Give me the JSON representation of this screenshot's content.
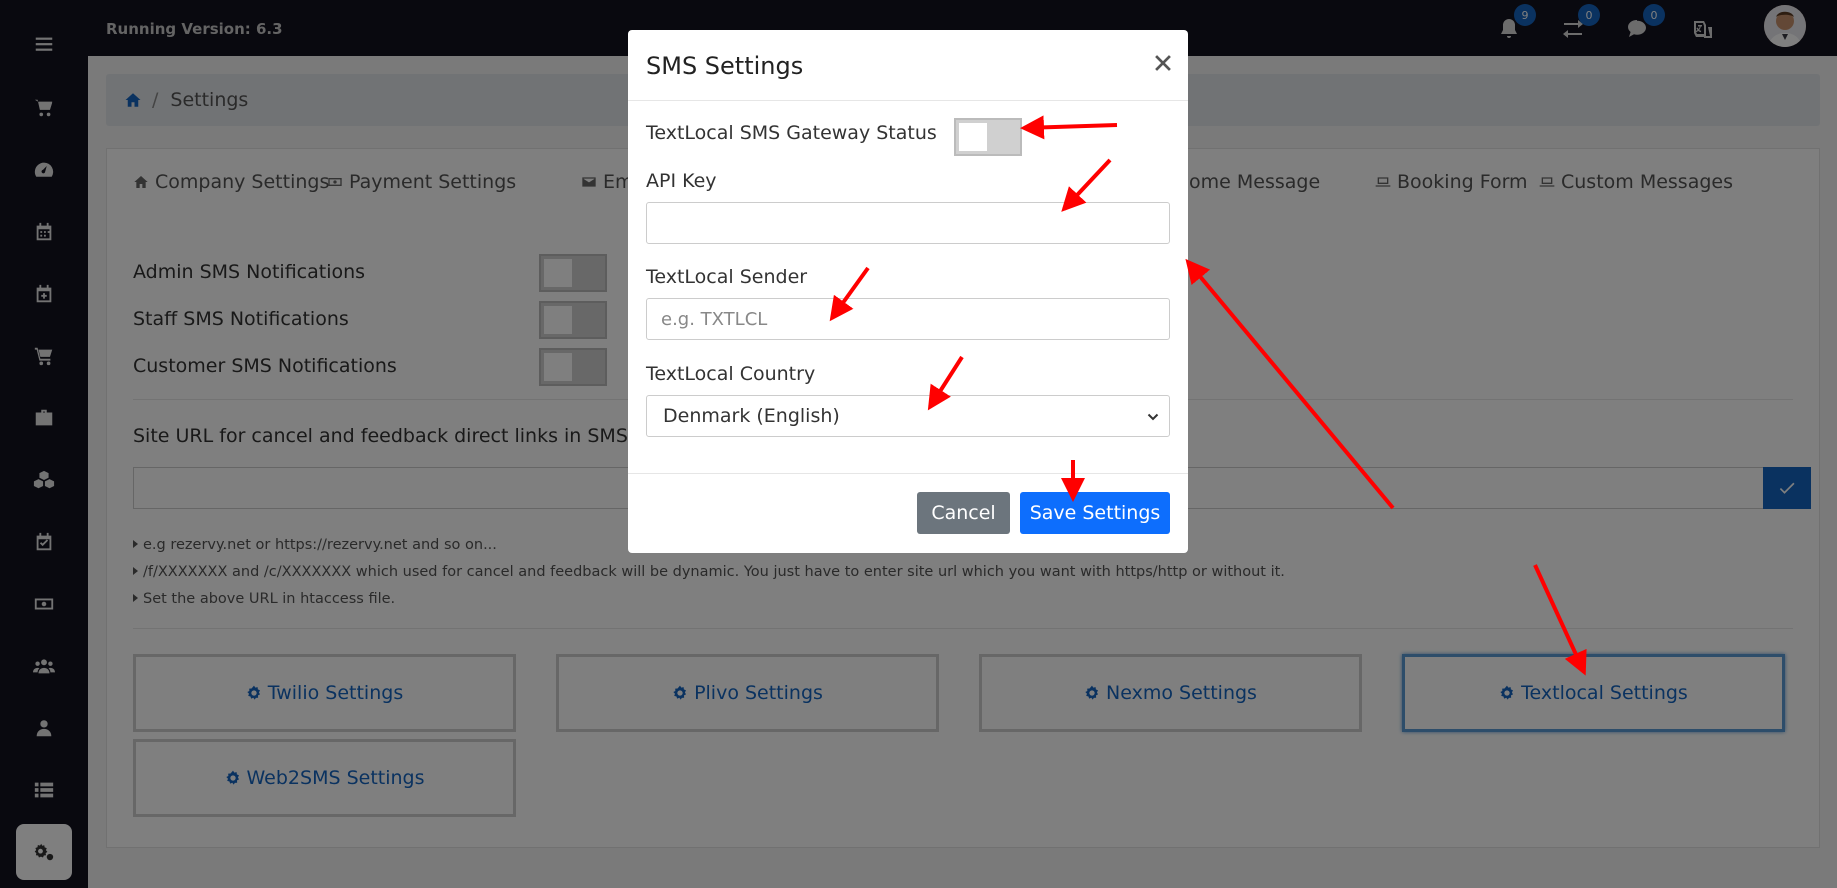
{
  "topbar": {
    "version": "Running Version: 6.3",
    "badges": {
      "notifications": "9",
      "transfers": "0",
      "messages": "0"
    }
  },
  "breadcrumb": {
    "separator": "/",
    "current": "Settings"
  },
  "tabs": [
    {
      "label": "Company Settings",
      "icon": "home-icon"
    },
    {
      "label": "Payment Settings",
      "icon": "money-icon"
    },
    {
      "label": "Em",
      "icon": "envelope-icon"
    },
    {
      "label": "ome Message",
      "icon": ""
    },
    {
      "label": "Booking Form",
      "icon": "laptop-icon"
    },
    {
      "label": "Custom Messages",
      "icon": "laptop-icon"
    }
  ],
  "notifications": {
    "admin": "Admin SMS Notifications",
    "staff": "Staff SMS Notifications",
    "customer": "Customer SMS Notifications"
  },
  "site_url": {
    "label": "Site URL for cancel and feedback direct links in SMS",
    "hints": [
      "e.g rezervy.net or https://rezervy.net and so on...",
      "/f/XXXXXXX and /c/XXXXXXX which used for cancel and feedback will be dynamic. You just have to enter site url which you want with https/http or without it.",
      "Set the above URL in htaccess file."
    ]
  },
  "providers": {
    "twilio": "Twilio Settings",
    "plivo": "Plivo Settings",
    "nexmo": "Nexmo Settings",
    "textlocal": "Textlocal Settings",
    "web2sms": "Web2SMS Settings"
  },
  "modal": {
    "title": "SMS Settings",
    "status_label": "TextLocal SMS Gateway Status",
    "status_on": false,
    "api_key_label": "API Key",
    "api_key_value": "",
    "sender_label": "TextLocal Sender",
    "sender_placeholder": "e.g. TXTLCL",
    "country_label": "TextLocal Country",
    "country_value": "Denmark (English)",
    "cancel_label": "Cancel",
    "save_label": "Save Settings"
  },
  "colors": {
    "sidebar_bg": "#13121f",
    "primary": "#1565c0",
    "save_button": "#0d6efd",
    "cancel_button": "#6c757d",
    "annotation_arrow": "#ff0000"
  }
}
